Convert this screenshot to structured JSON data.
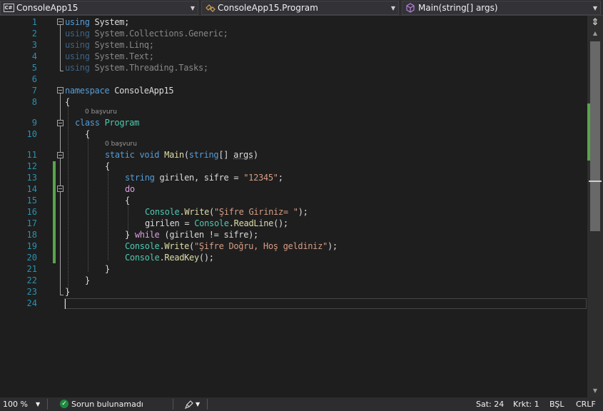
{
  "navigation": {
    "project": {
      "icon": "csharp-project-icon",
      "label": "ConsoleApp15"
    },
    "type": {
      "icon": "class-icon",
      "label": "ConsoleApp15.Program"
    },
    "member": {
      "icon": "method-icon",
      "label": "Main(string[] args)"
    }
  },
  "editor": {
    "line_numbers": [
      "1",
      "2",
      "3",
      "4",
      "5",
      "6",
      "7",
      "8",
      "9",
      "10",
      "11",
      "12",
      "13",
      "14",
      "15",
      "16",
      "17",
      "18",
      "19",
      "20",
      "21",
      "22",
      "23",
      "24"
    ],
    "codelens": {
      "class_refs": "0 başvuru",
      "method_refs": "0 başvuru"
    },
    "code": {
      "l1": {
        "kw": "using",
        "rest": " System;"
      },
      "l2": {
        "kw": "using",
        "rest": " System.Collections.Generic;"
      },
      "l3": {
        "kw": "using",
        "rest": " System.Linq;"
      },
      "l4": {
        "kw": "using",
        "rest": " System.Text;"
      },
      "l5": {
        "kw": "using",
        "rest": " System.Threading.Tasks;"
      },
      "l7": {
        "kw": "namespace",
        "rest": " ConsoleApp15"
      },
      "l8": "{",
      "l9": {
        "kw": "class",
        "type": "Program"
      },
      "l10": "{",
      "l11": {
        "kw1": "static",
        "kw2": "void",
        "method": "Main",
        "p1": "(",
        "kw3": "string",
        "p2": "[] ",
        "param": "args",
        "p3": ")"
      },
      "l12": "{",
      "l13": {
        "kw": "string",
        "rest1": " girilen, sifre = ",
        "str": "\"12345\"",
        "rest2": ";"
      },
      "l14": {
        "ctl": "do"
      },
      "l15": "{",
      "l16": {
        "type": "Console",
        "dot": ".",
        "method": "Write",
        "p1": "(",
        "str": "\"Şifre Giriniz= \"",
        "p2": ");"
      },
      "l17": {
        "pre": "girilen = ",
        "type": "Console",
        "dot": ".",
        "method": "ReadLine",
        "post": "();"
      },
      "l18": {
        "pre": "} ",
        "ctl": "while",
        "post": " (girilen != sifre);"
      },
      "l19": {
        "type": "Console",
        "dot": ".",
        "method": "Write",
        "p1": "(",
        "str": "\"Şifre Doğru, Hoş geldiniz\"",
        "p2": ");"
      },
      "l20": {
        "type": "Console",
        "dot": ".",
        "method": "ReadKey",
        "post": "();"
      },
      "l21": "}",
      "l22": "}",
      "l23": "}"
    }
  },
  "statusbar": {
    "zoom": "100 %",
    "issues": "Sorun bulunamadı",
    "line": "Sat: 24",
    "col": "Krkt: 1",
    "insert_mode": "BŞL",
    "line_ending": "CRLF"
  },
  "colors": {
    "keyword": "#569cd6",
    "type": "#4ec9b0",
    "string": "#d69d85",
    "control": "#d8a0df",
    "method": "#dcdcaa",
    "line_number": "#2b91af",
    "change_marker": "#57a64a"
  }
}
